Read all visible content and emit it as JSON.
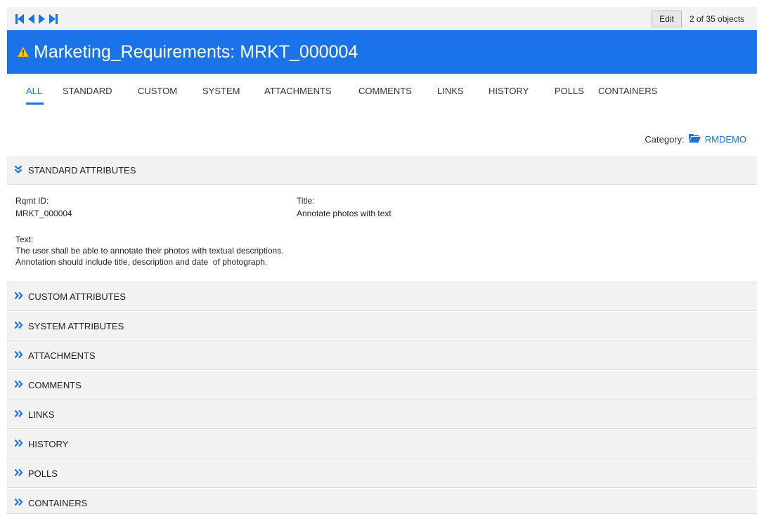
{
  "toolbar": {
    "edit_label": "Edit",
    "object_count": "2 of 35 objects"
  },
  "header": {
    "title": "Marketing_Requirements: MRKT_000004",
    "status_icon": "warning-icon",
    "background_color": "#1a73e8"
  },
  "tabs": [
    {
      "label": "ALL",
      "active": true
    },
    {
      "label": "STANDARD"
    },
    {
      "label": "CUSTOM"
    },
    {
      "label": "SYSTEM"
    },
    {
      "label": "ATTACHMENTS"
    },
    {
      "label": "COMMENTS"
    },
    {
      "label": "LINKS"
    },
    {
      "label": "HISTORY"
    },
    {
      "label": "POLLS"
    },
    {
      "label": "CONTAINERS"
    }
  ],
  "category": {
    "label": "Category:",
    "value": "RMDEMO",
    "icon": "folder-open-icon"
  },
  "sections": {
    "standard": {
      "label": "STANDARD ATTRIBUTES",
      "expanded": true,
      "rqmt_id_label": "Rqmt ID:",
      "rqmt_id_value": "MRKT_000004",
      "title_label": "Title:",
      "title_value": "Annotate photos with text",
      "text_label": "Text:",
      "text_line1": "The user shall be able to annotate their photos with textual descriptions.",
      "text_line2": "Annotation should include title, description and date  of photograph."
    },
    "collapsed": [
      "CUSTOM ATTRIBUTES",
      "SYSTEM ATTRIBUTES",
      "ATTACHMENTS",
      "COMMENTS",
      "LINKS",
      "HISTORY",
      "POLLS",
      "CONTAINERS"
    ]
  }
}
